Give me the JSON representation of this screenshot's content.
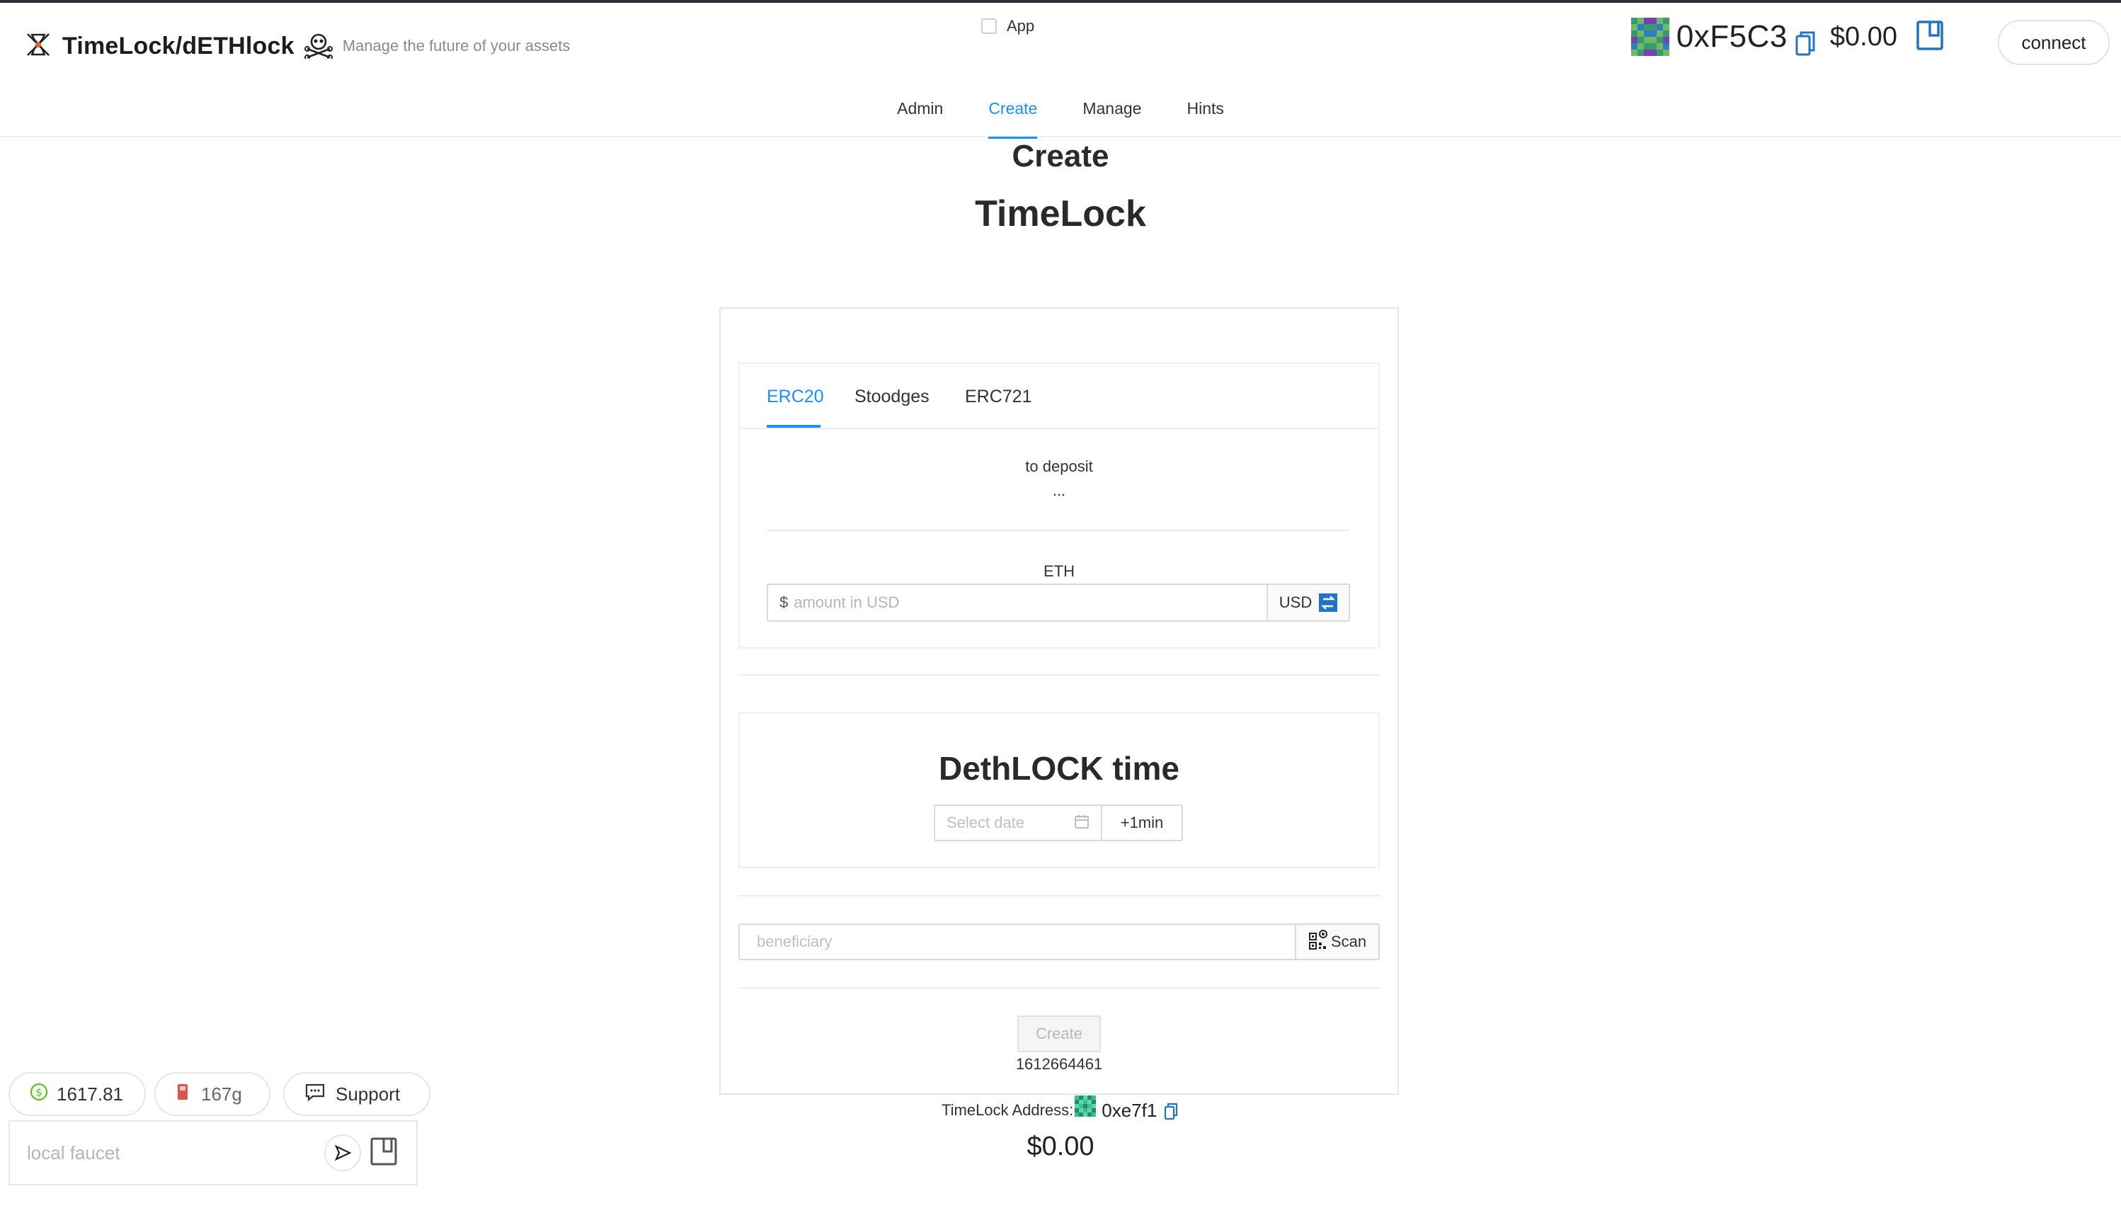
{
  "app": {
    "title": "TimeLock/dETHlock",
    "subtitle": "Manage the future of your assets"
  },
  "app_toggle": {
    "label": "App",
    "checked": false
  },
  "account": {
    "address": "0xF5C3",
    "balance": "$0.00",
    "connect_label": "connect"
  },
  "nav": {
    "tabs": [
      {
        "label": "Admin",
        "active": false
      },
      {
        "label": "Create",
        "active": true
      },
      {
        "label": "Manage",
        "active": false
      },
      {
        "label": "Hints",
        "active": false
      }
    ]
  },
  "page": {
    "heading": "Create",
    "subheading": "TimeLock"
  },
  "asset_tabs": [
    {
      "label": "ERC20",
      "active": true
    },
    {
      "label": "Stoodges",
      "active": false
    },
    {
      "label": "ERC721",
      "active": false
    }
  ],
  "deposit": {
    "label": "to deposit",
    "value": "...",
    "token": "ETH",
    "amount_prefix": "$",
    "amount_placeholder": "amount in USD",
    "unit_label": "USD"
  },
  "lock_time": {
    "title": "DethLOCK time",
    "date_placeholder": "Select date",
    "plus_button": "+1min"
  },
  "beneficiary": {
    "placeholder": "beneficiary",
    "scan_label": "Scan"
  },
  "create": {
    "button_label": "Create",
    "timestamp": "1612664461"
  },
  "timelock": {
    "address_label": "TimeLock Address:",
    "address": "0xe7f1",
    "balance": "$0.00"
  },
  "footer": {
    "eth_price": "1617.81",
    "gas_price": "167g",
    "support_label": "Support",
    "faucet_placeholder": "local faucet"
  },
  "colors": {
    "accent": "#1890ff",
    "copy_icon": "#1f74c9",
    "price_icon": "#52c41a",
    "gas_icon": "#d9534f"
  },
  "icons": {
    "brand_left": "hourglass-cross-icon",
    "brand_right": "skull-crossbones-icon",
    "copy": "copy-icon",
    "wallet": "wallet-icon",
    "calendar": "calendar-icon",
    "swap": "swap-icon",
    "qr": "qr-code-icon",
    "send": "send-icon"
  }
}
